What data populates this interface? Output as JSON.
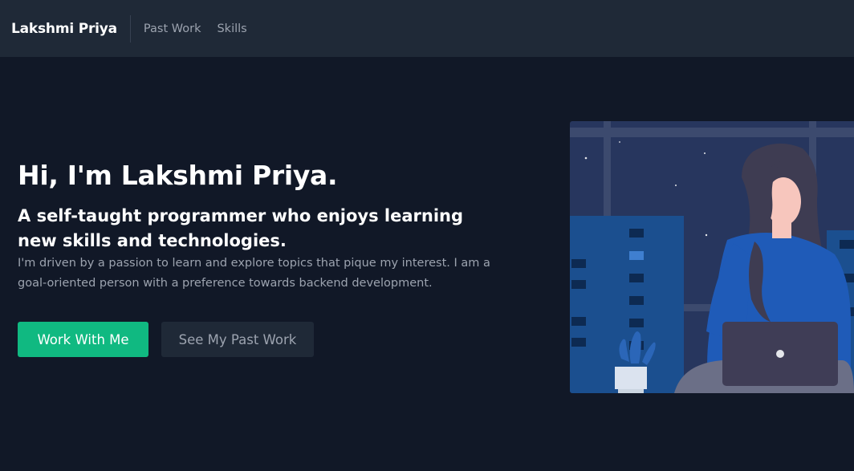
{
  "nav": {
    "brand": "Lakshmi Priya",
    "links": [
      {
        "label": "Past Work"
      },
      {
        "label": "Skills"
      }
    ]
  },
  "hero": {
    "headline": "Hi, I'm Lakshmi Priya.",
    "subheadline": "A self-taught programmer who enjoys learning new skills and technologies.",
    "description": "I'm driven by a passion to learn and explore topics that pique my interest. I am a goal-oriented person with a preference towards backend development.",
    "primary_button": "Work With Me",
    "secondary_button": "See My Past Work"
  },
  "colors": {
    "background": "#111827",
    "navbar": "#1f2937",
    "accent": "#10b981",
    "muted_text": "#9ca3af"
  }
}
